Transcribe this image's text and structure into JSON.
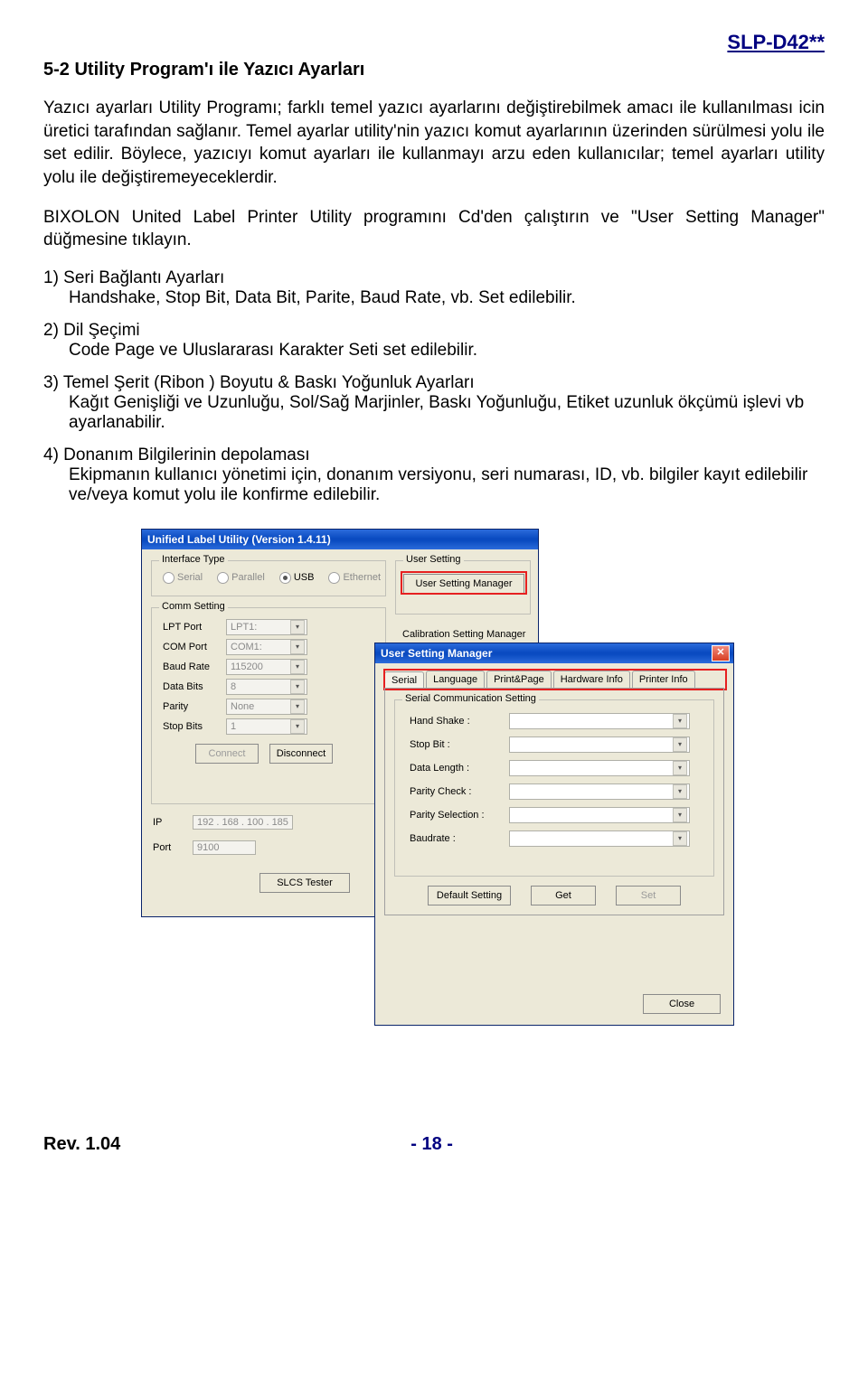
{
  "header": {
    "model": "SLP-D42**"
  },
  "section": {
    "title": "5-2 Utility Program'ı ile Yazıcı Ayarları",
    "p1": "Yazıcı ayarları Utility Programı; farklı temel yazıcı ayarlarını değiştirebilmek amacı ile kullanılması icin üretici tarafından sağlanır. Temel ayarlar utility'nin yazıcı komut ayarlarının üzerinden sürülmesi yolu ile set edilir. Böylece, yazıcıyı komut ayarları ile kullanmayı arzu eden kullanıcılar; temel ayarları utility yolu ile değiştiremeyeceklerdir.",
    "p2": "BIXOLON United Label Printer Utility programını Cd'den çalıştırın ve \"User Setting Manager\" düğmesine tıklayın.",
    "items": {
      "i1_head": "1) Seri Bağlantı Ayarları",
      "i1_sub": "Handshake, Stop Bit, Data Bit, Parite, Baud Rate, vb.    Set edilebilir.",
      "i2_head": "2) Dil Şeçimi",
      "i2_sub": "Code Page ve Uluslararası Karakter Seti set edilebilir.",
      "i3_head": "3) Temel Şerit (Ribon ) Boyutu & Baskı Yoğunluk Ayarları",
      "i3_sub": "Kağıt Genişliği ve Uzunluğu, Sol/Sağ Marjinler, Baskı Yoğunluğu, Etiket uzunluk ökçümü işlevi vb ayarlanabilir.",
      "i4_head": "4) Donanım Bilgilerinin depolaması",
      "i4_sub": "Ekipmanın kullanıcı yönetimi için, donanım versiyonu, seri numarası, ID, vb. bilgiler kayıt edilebilir ve/veya komut yolu ile konfirme edilebilir."
    }
  },
  "win1": {
    "title": "Unified Label Utility  (Version 1.4.11)",
    "interface_legend": "Interface Type",
    "radios": {
      "serial": "Serial",
      "parallel": "Parallel",
      "usb": "USB",
      "ethernet": "Ethernet"
    },
    "comm_legend": "Comm Setting",
    "fields": {
      "lpt": "LPT Port",
      "lpt_val": "LPT1:",
      "com": "COM Port",
      "com_val": "COM1:",
      "baud": "Baud Rate",
      "baud_val": "115200",
      "databits": "Data Bits",
      "databits_val": "8",
      "parity": "Parity",
      "parity_val": "None",
      "stopbits": "Stop Bits",
      "stopbits_val": "1"
    },
    "btn_connect": "Connect",
    "btn_disconnect": "Disconnect",
    "ip_label": "IP",
    "ip_val": "192  .  168  .  100  .  185",
    "port_label": "Port",
    "port_val": "9100",
    "slcs": "SLCS Tester",
    "usersetting_legend": "User Setting",
    "usm_btn": "User Setting Manager",
    "calib_legend": "Calibration Setting Manager"
  },
  "win2": {
    "title": "User Setting Manager",
    "tabs": {
      "serial": "Serial",
      "language": "Language",
      "printpage": "Print&Page",
      "hw": "Hardware Info",
      "printer": "Printer Info"
    },
    "scs_legend": "Serial Communication Setting",
    "rows": {
      "handshake": "Hand Shake :",
      "stopbit": "Stop Bit :",
      "datalen": "Data Length :",
      "parityc": "Parity Check :",
      "paritys": "Parity Selection :",
      "baud": "Baudrate :"
    },
    "btns": {
      "default": "Default Setting",
      "get": "Get",
      "set": "Set",
      "close": "Close"
    }
  },
  "footer": {
    "rev": "Rev. 1.04",
    "page": "- 18 -"
  }
}
